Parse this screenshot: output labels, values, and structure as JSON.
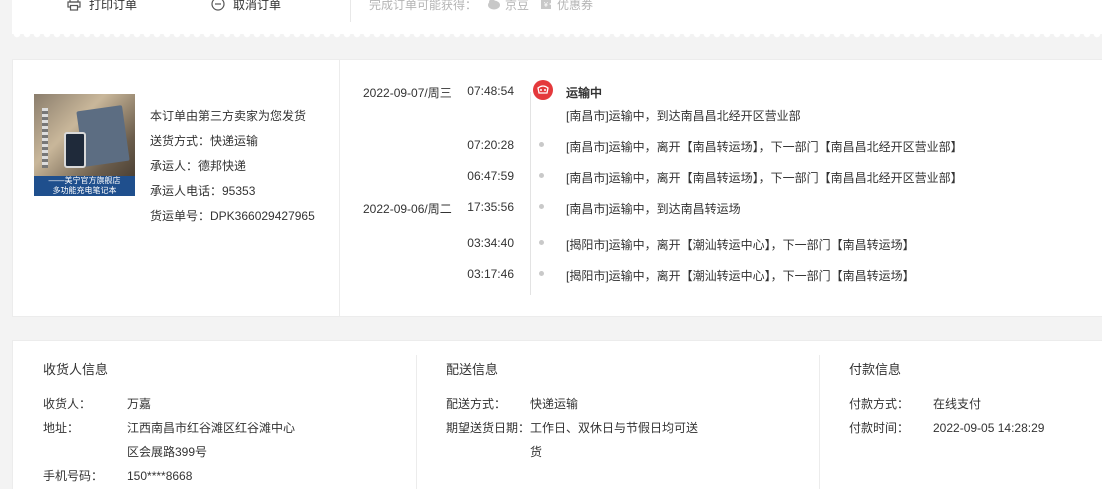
{
  "actions": {
    "print_label": "打印订单",
    "cancel_label": "取消订单",
    "reward_label": "完成订单可能获得：",
    "jingdou_label": "京豆",
    "coupon_label": "优惠券"
  },
  "product": {
    "banner_line1": "——美宁官方旗舰店",
    "banner_line2": "多功能充电笔记本"
  },
  "shipping": {
    "notice": "本订单由第三方卖家为您发货",
    "method": "送货方式：快递运输",
    "carrier": "承运人：德邦快递",
    "carrier_phone": "承运人电话：95353",
    "tracking_no": "货运单号：DPK366029427965"
  },
  "timeline": {
    "status": "运输中",
    "events": [
      {
        "date": "2022-09-07/周三",
        "time": "07:48:54",
        "text": "[南昌市]运输中，到达南昌昌北经开区营业部"
      },
      {
        "date": "",
        "time": "07:20:28",
        "text": "[南昌市]运输中，离开【南昌转运场】，下一部门【南昌昌北经开区营业部】"
      },
      {
        "date": "",
        "time": "06:47:59",
        "text": "[南昌市]运输中，离开【南昌转运场】，下一部门【南昌昌北经开区营业部】"
      },
      {
        "date": "2022-09-06/周二",
        "time": "17:35:56",
        "text": "[南昌市]运输中，到达南昌转运场"
      },
      {
        "date": "",
        "time": "03:34:40",
        "text": "[揭阳市]运输中，离开【潮汕转运中心】，下一部门【南昌转运场】"
      },
      {
        "date": "",
        "time": "03:17:46",
        "text": "[揭阳市]运输中，离开【潮汕转运中心】，下一部门【南昌转运场】"
      }
    ]
  },
  "consignee": {
    "title": "收货人信息",
    "name_label": "收货人：",
    "name": "万嘉",
    "address_label": "地址：",
    "address_line1": "江西南昌市红谷滩区红谷滩中心",
    "address_line2": "区会展路399号",
    "phone_label": "手机号码：",
    "phone": "150****8668"
  },
  "delivery": {
    "title": "配送信息",
    "method_label": "配送方式：",
    "method": "快递运输",
    "date_label": "期望送货日期：",
    "date_line1": "工作日、双休日与节假日均可送",
    "date_line2": "货"
  },
  "payment": {
    "title": "付款信息",
    "method_label": "付款方式：",
    "method": "在线支付",
    "time_label": "付款时间：",
    "time": "2022-09-05 14:28:29"
  },
  "colors": {
    "accent_red": "#e4393c",
    "banner_blue": "#1f4f8d"
  }
}
